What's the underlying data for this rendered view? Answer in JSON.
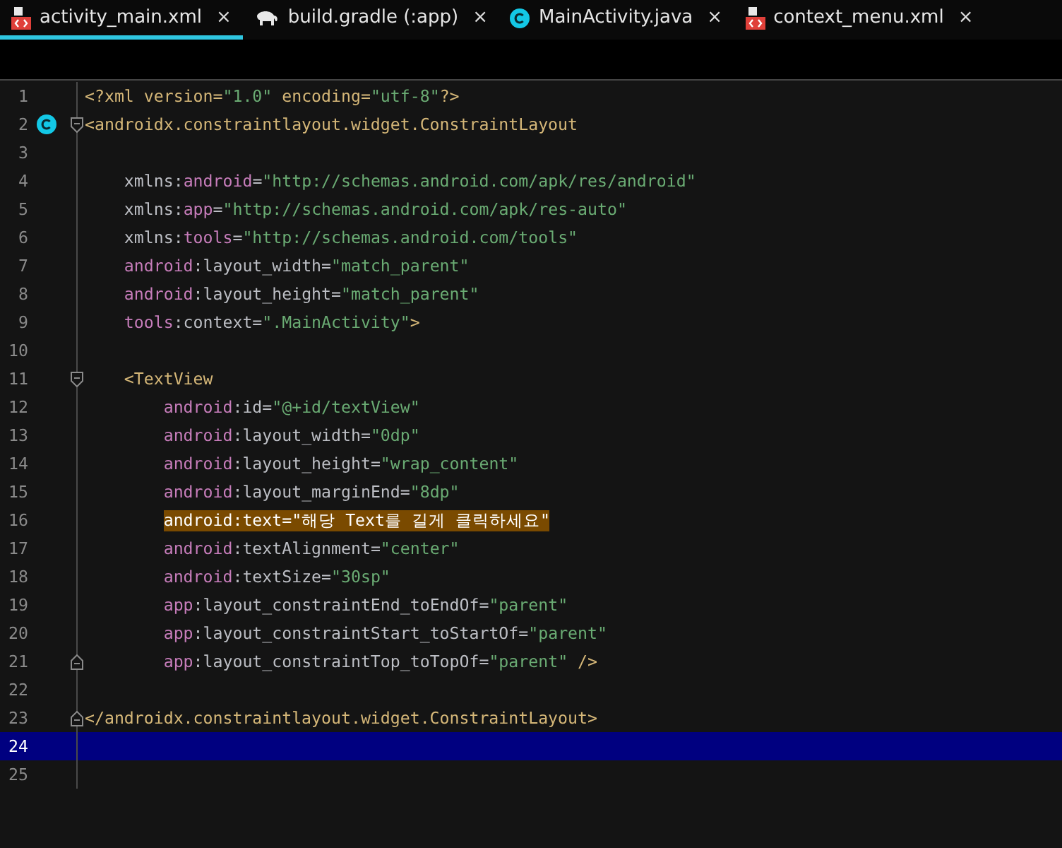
{
  "tabs": [
    {
      "label": "activity_main.xml",
      "kind": "xml",
      "selected": true,
      "close": "×"
    },
    {
      "label": "build.gradle (:app)",
      "kind": "gradle",
      "selected": false,
      "close": "×"
    },
    {
      "label": "MainActivity.java",
      "kind": "class",
      "selected": false,
      "close": "×"
    },
    {
      "label": "context_menu.xml",
      "kind": "xml",
      "selected": false,
      "close": "×"
    }
  ],
  "editor": {
    "lines": [
      {
        "number": "1",
        "text": "<?xml version=\"1.0\" encoding=\"utf-8\"?>"
      },
      {
        "number": "2",
        "class_marker": true,
        "fold_start": true,
        "text": "<androidx.constraintlayout.widget.ConstraintLayout"
      },
      {
        "number": "3"
      },
      {
        "number": "4",
        "text": "    xmlns:android=\"http://schemas.android.com/apk/res/android\""
      },
      {
        "number": "5",
        "text": "    xmlns:app=\"http://schemas.android.com/apk/res-auto\""
      },
      {
        "number": "6",
        "text": "    xmlns:tools=\"http://schemas.android.com/tools\""
      },
      {
        "number": "7",
        "text": "    android:layout_width=\"match_parent\""
      },
      {
        "number": "8",
        "text": "    android:layout_height=\"match_parent\""
      },
      {
        "number": "9",
        "text": "    tools:context=\".MainActivity\">"
      },
      {
        "number": "10"
      },
      {
        "number": "11",
        "fold_start": true,
        "text": "    <TextView"
      },
      {
        "number": "12",
        "text": "        android:id=\"@+id/textView\""
      },
      {
        "number": "13",
        "text": "        android:layout_width=\"0dp\""
      },
      {
        "number": "14",
        "text": "        android:layout_height=\"wrap_content\""
      },
      {
        "number": "15",
        "text": "        android:layout_marginEnd=\"8dp\""
      },
      {
        "number": "16",
        "highlighted": true,
        "text": "        android:text=\"해당 Text를 길게 클릭하세요\""
      },
      {
        "number": "17",
        "text": "        android:textAlignment=\"center\""
      },
      {
        "number": "18",
        "text": "        android:textSize=\"30sp\""
      },
      {
        "number": "19",
        "text": "        app:layout_constraintEnd_toEndOf=\"parent\""
      },
      {
        "number": "20",
        "text": "        app:layout_constraintStart_toStartOf=\"parent\""
      },
      {
        "number": "21",
        "fold_end": true,
        "text": "        app:layout_constraintTop_toTopOf=\"parent\" />"
      },
      {
        "number": "22"
      },
      {
        "number": "23",
        "fold_end": true,
        "text": "</androidx.constraintlayout.widget.ConstraintLayout>"
      },
      {
        "number": "24",
        "current": true
      },
      {
        "number": "25"
      }
    ]
  }
}
